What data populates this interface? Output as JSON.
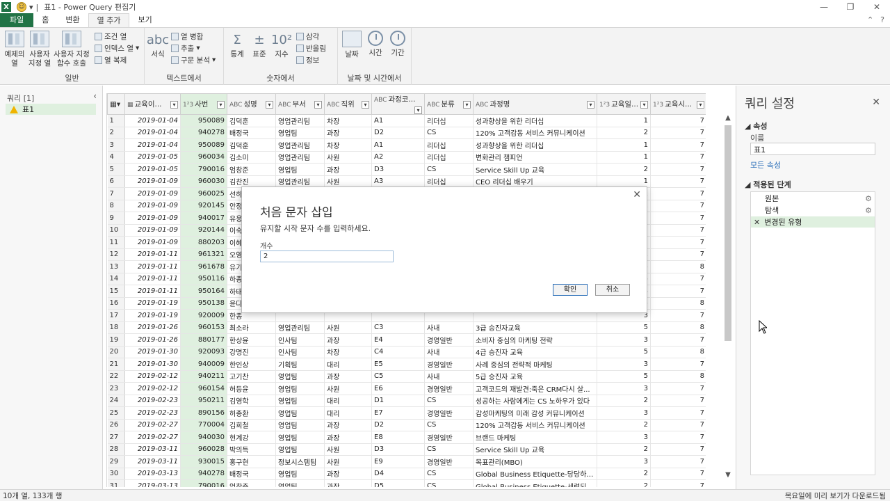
{
  "titlebar": {
    "app_icon": "X",
    "separator": "|",
    "title": "표1 - Power Query 편집기"
  },
  "tabs": [
    "파일",
    "홈",
    "변환",
    "열 추가",
    "보기"
  ],
  "ribbon": {
    "general": {
      "label": "일반",
      "examples_col": "예제의\n열",
      "custom_col": "사용자\n지정 열",
      "invoke_custom_fn": "사용자 지정\n함수 호출",
      "conditional_col": "조건 열",
      "index_col": "인덱스 열",
      "duplicate_col": "열 복제"
    },
    "text": {
      "label": "텍스트에서",
      "format": "서식",
      "merge_cols": "열 병합",
      "extract": "추출",
      "parse": "구문 분석"
    },
    "number": {
      "label": "숫자에서",
      "statistics": "통계",
      "standard": "표준",
      "scientific": "지수",
      "trigonometry": "삼각",
      "rounding": "반올림",
      "information": "정보"
    },
    "datetime": {
      "label": "날짜 및 시간에서",
      "date": "날짜",
      "time": "시간",
      "duration": "기간"
    }
  },
  "left_pane": {
    "header": "쿼리 [1]",
    "query": "표1"
  },
  "grid": {
    "columns": [
      "교육이...",
      "사번",
      "성명",
      "부서",
      "직위",
      "과정코...",
      "분류",
      "과정명",
      "교육일...",
      "교육시..."
    ],
    "rows": [
      [
        "1",
        "2019-01-04",
        "950089",
        "김덕훈",
        "영업관리팀",
        "차장",
        "A1",
        "리더십",
        "성과향상을 위한 리더십",
        "1",
        "7"
      ],
      [
        "2",
        "2019-01-04",
        "940278",
        "배정국",
        "영업팀",
        "과장",
        "D2",
        "CS",
        "120% 고객감동 서비스 커뮤니케이션",
        "2",
        "7"
      ],
      [
        "3",
        "2019-01-04",
        "950089",
        "김덕훈",
        "영업관리팀",
        "차장",
        "A1",
        "리더십",
        "성과향상을 위한 리더십",
        "1",
        "7"
      ],
      [
        "4",
        "2019-01-05",
        "960034",
        "김소미",
        "영업관리팀",
        "사원",
        "A2",
        "리더십",
        "변화관리 챔피언",
        "1",
        "7"
      ],
      [
        "5",
        "2019-01-05",
        "790016",
        "엄창준",
        "영업팀",
        "과장",
        "D3",
        "CS",
        "Service Skill Up 교육",
        "2",
        "7"
      ],
      [
        "6",
        "2019-01-09",
        "960030",
        "김찬진",
        "영업관리팀",
        "사원",
        "A3",
        "리더십",
        "CEO 리더십 배우기",
        "1",
        "7"
      ],
      [
        "7",
        "2019-01-09",
        "960025",
        "선하라",
        "영업관리팀",
        "대리",
        "B1",
        "윤리",
        "비즈니스 최고에 도전하자",
        "1",
        "7"
      ],
      [
        "8",
        "2019-01-09",
        "920145",
        "안정",
        "",
        "",
        "",
        "",
        "",
        "1",
        "7"
      ],
      [
        "9",
        "2019-01-09",
        "940017",
        "유응",
        "",
        "",
        "",
        "",
        "",
        "2",
        "7"
      ],
      [
        "10",
        "2019-01-09",
        "920144",
        "이숙",
        "",
        "",
        "",
        "",
        "",
        "2",
        "7"
      ],
      [
        "11",
        "2019-01-09",
        "880203",
        "이혜",
        "",
        "",
        "",
        "",
        "",
        "2",
        "7"
      ],
      [
        "12",
        "2019-01-11",
        "961321",
        "오영",
        "",
        "",
        "",
        "",
        "",
        "1",
        "7"
      ],
      [
        "13",
        "2019-01-11",
        "961678",
        "유기",
        "",
        "",
        "",
        "",
        "",
        "5",
        "8"
      ],
      [
        "14",
        "2019-01-11",
        "950116",
        "하종",
        "",
        "",
        "",
        "",
        "",
        "3",
        "7"
      ],
      [
        "15",
        "2019-01-11",
        "950164",
        "하태",
        "",
        "",
        "",
        "",
        "",
        "3",
        "7"
      ],
      [
        "16",
        "2019-01-19",
        "950138",
        "윤다",
        "",
        "",
        "",
        "",
        "",
        "5",
        "8"
      ],
      [
        "17",
        "2019-01-19",
        "920009",
        "한종",
        "",
        "",
        "",
        "",
        "",
        "3",
        "7"
      ],
      [
        "18",
        "2019-01-26",
        "960153",
        "최소라",
        "영업관리팀",
        "사원",
        "C3",
        "사내",
        "3급 승진자교육",
        "5",
        "8"
      ],
      [
        "19",
        "2019-01-26",
        "880177",
        "한상윤",
        "인사팀",
        "과장",
        "E4",
        "경영일반",
        "소비자 중심의 마케팅 전략",
        "3",
        "7"
      ],
      [
        "20",
        "2019-01-30",
        "920093",
        "강명진",
        "인사팀",
        "차장",
        "C4",
        "사내",
        "4급 승진자 교육",
        "5",
        "8"
      ],
      [
        "21",
        "2019-01-30",
        "940009",
        "한인상",
        "기획팀",
        "대리",
        "E5",
        "경영일반",
        "사례 중심의 전략적 마케팅",
        "3",
        "7"
      ],
      [
        "22",
        "2019-02-12",
        "940211",
        "고기찬",
        "영업팀",
        "과장",
        "C5",
        "사내",
        "5급 승진자 교육",
        "5",
        "8"
      ],
      [
        "23",
        "2019-02-12",
        "960154",
        "허등윤",
        "영업팀",
        "사원",
        "E6",
        "경영일반",
        "고객코드의 재발견:죽은 CRM다시 살...",
        "3",
        "7"
      ],
      [
        "24",
        "2019-02-23",
        "950211",
        "김영학",
        "영업팀",
        "대리",
        "D1",
        "CS",
        "성공하는 사람에게는 CS 노하우가 있다",
        "2",
        "7"
      ],
      [
        "25",
        "2019-02-23",
        "890156",
        "허종환",
        "영업팀",
        "대리",
        "E7",
        "경영일반",
        "감성마케팅의 미래 감성 커뮤니케이션",
        "3",
        "7"
      ],
      [
        "26",
        "2019-02-27",
        "770004",
        "김희철",
        "영업팀",
        "과장",
        "D2",
        "CS",
        "120% 고객감동 서비스 커뮤니케이션",
        "2",
        "7"
      ],
      [
        "27",
        "2019-02-27",
        "940030",
        "현계강",
        "영업팀",
        "과장",
        "E8",
        "경영일반",
        "브랜드 마케팅",
        "3",
        "7"
      ],
      [
        "28",
        "2019-03-11",
        "960028",
        "박의득",
        "영업팀",
        "사원",
        "D3",
        "CS",
        "Service Skill Up 교육",
        "2",
        "7"
      ],
      [
        "29",
        "2019-03-11",
        "930015",
        "홍구현",
        "정보시스템팀",
        "사원",
        "E9",
        "경영일반",
        "목표관리(MBO)",
        "3",
        "7"
      ],
      [
        "30",
        "2019-03-13",
        "940278",
        "배정국",
        "영업팀",
        "과장",
        "D4",
        "CS",
        "Global Business Etiquette-당당하게 Biz...",
        "2",
        "7"
      ],
      [
        "31",
        "2019-03-13",
        "790016",
        "엄창준",
        "영업팀",
        "과장",
        "D5",
        "CS",
        "Global Business Etiquette-세련되게 접...",
        "2",
        "7"
      ]
    ]
  },
  "right_pane": {
    "title": "쿼리 설정",
    "properties_header": "속성",
    "name_label": "이름",
    "name_value": "표1",
    "all_properties_link": "모든 속성",
    "applied_steps_header": "적용된 단계",
    "steps": [
      "원본",
      "탐색",
      "변경된 유형"
    ]
  },
  "statusbar": {
    "left": "10개 열, 133개 행",
    "right": "목요일에 미리 보기가 다운로드됨"
  },
  "dialog": {
    "title": "처음 문자 삽입",
    "description": "유지할 시작 문자 수를 입력하세요.",
    "count_label": "개수",
    "count_value": "2",
    "ok_label": "확인",
    "cancel_label": "취소"
  },
  "colors": {
    "excel_green": "#217346",
    "selection_green": "#dff0df",
    "link_blue": "#2a6eb8"
  }
}
